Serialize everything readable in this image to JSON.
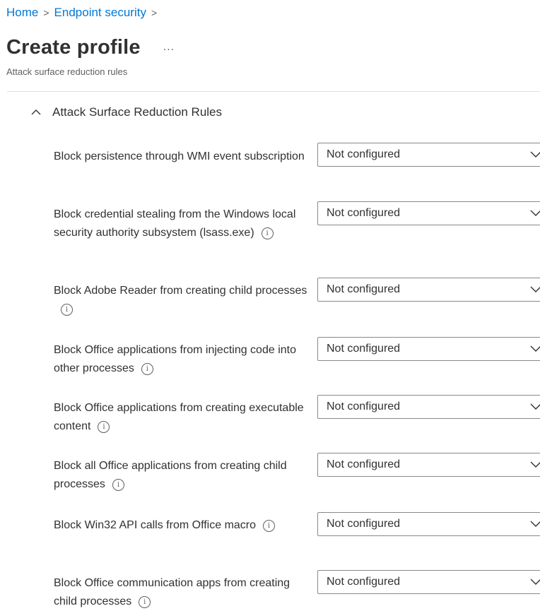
{
  "breadcrumb": {
    "home": "Home",
    "endpoint_security": "Endpoint security",
    "separator": ">"
  },
  "page": {
    "title": "Create profile",
    "more": "...",
    "subtitle": "Attack surface reduction rules"
  },
  "section": {
    "title": "Attack Surface Reduction Rules"
  },
  "rules": [
    {
      "label": "Block persistence through WMI event subscription",
      "info": false,
      "value": "Not configured"
    },
    {
      "label": "Block credential stealing from the Windows local security authority subsystem (lsass.exe)",
      "info": true,
      "value": "Not configured"
    },
    {
      "label": "Block Adobe Reader from creating child processes",
      "info": true,
      "value": "Not configured"
    },
    {
      "label": "Block Office applications from injecting code into other processes",
      "info": true,
      "value": "Not configured"
    },
    {
      "label": "Block Office applications from creating executable content",
      "info": true,
      "value": "Not configured"
    },
    {
      "label": "Block all Office applications from creating child processes",
      "info": true,
      "value": "Not configured"
    },
    {
      "label": "Block Win32 API calls from Office macro",
      "info": true,
      "value": "Not configured"
    },
    {
      "label": "Block Office communication apps from creating child processes",
      "info": true,
      "value": "Not configured"
    }
  ],
  "icons": {
    "info": "ⓘ",
    "chevron_up": "chevron-up-icon",
    "chevron_down": "chevron-down-icon"
  },
  "colors": {
    "link": "#0078d4",
    "text": "#323130",
    "muted": "#605e5c",
    "border": "#8a8886"
  }
}
